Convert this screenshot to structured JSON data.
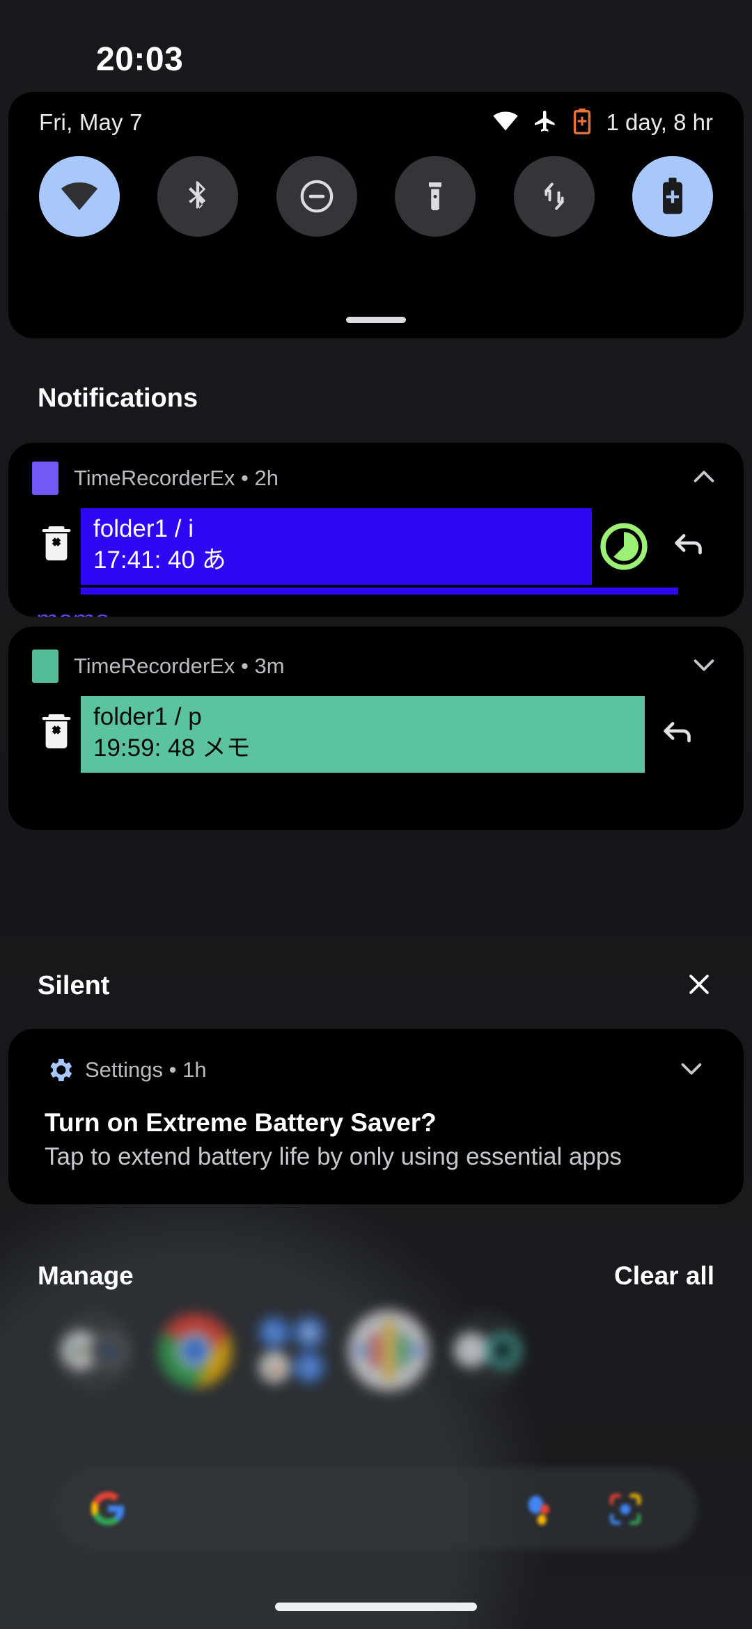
{
  "status_bar": {
    "clock": "20:03"
  },
  "quick_settings": {
    "date": "Fri, May 7",
    "battery_estimate": "1 day, 8 hr",
    "status_icons": [
      {
        "name": "wifi-icon"
      },
      {
        "name": "airplane-mode-icon"
      },
      {
        "name": "battery-saver-icon",
        "color": "#e8703a"
      }
    ],
    "tiles": [
      {
        "name": "wifi-tile",
        "icon": "wifi-icon",
        "active": true
      },
      {
        "name": "bluetooth-tile",
        "icon": "bluetooth-icon",
        "active": false
      },
      {
        "name": "dnd-tile",
        "icon": "do-not-disturb-icon",
        "active": false
      },
      {
        "name": "flashlight-tile",
        "icon": "flashlight-icon",
        "active": false
      },
      {
        "name": "auto-rotate-tile",
        "icon": "auto-rotate-icon",
        "active": false
      },
      {
        "name": "battery-saver-tile",
        "icon": "battery-plus-icon",
        "active": true
      }
    ],
    "active_tile_color": "#a8c7fa",
    "inactive_tile_color": "#333538"
  },
  "sections": {
    "notifications_label": "Notifications",
    "silent_label": "Silent",
    "silent_clear_icon": "close-icon"
  },
  "notifications": [
    {
      "app_name": "TimeRecorderEx",
      "time": "2h",
      "header": "TimeRecorderEx • 2h",
      "app_color": "#7259f5",
      "expand_icon": "chevron-up-icon",
      "delete_icon": "trash-x-icon",
      "line1": "folder1 / i",
      "line2": "17:41: 40 あ",
      "box_color": "#2f07f2",
      "text_color": "#ffffff",
      "timer_icon": "pie-timer-icon",
      "timer_color": "#9cf073",
      "reply_icon": "reply-icon",
      "action_label": "memo",
      "action_color": "#5b44e8",
      "has_progress": true
    },
    {
      "app_name": "TimeRecorderEx",
      "time": "3m",
      "header": "TimeRecorderEx • 3m",
      "app_color": "#53bc96",
      "expand_icon": "chevron-down-icon",
      "delete_icon": "trash-x-icon",
      "line1": "folder1 / p",
      "line2": "19:59: 48 メモ",
      "box_color": "#5bc3a0",
      "text_color": "#0a0a0a",
      "reply_icon": "reply-icon",
      "has_progress": false
    }
  ],
  "silent_notification": {
    "app_name": "Settings",
    "time": "1h",
    "header": "Settings • 1h",
    "app_icon": "gear-icon",
    "app_icon_color": "#a8c7fa",
    "expand_icon": "chevron-down-icon",
    "title": "Turn on Extreme Battery Saver?",
    "body": "Tap to extend battery life by only using essential apps"
  },
  "footer": {
    "manage_label": "Manage",
    "clear_all_label": "Clear all"
  },
  "home_screen": {
    "search_bar": {
      "google_icon": "google-g-icon",
      "mic_icon": "assistant-mic-icon",
      "lens_icon": "google-lens-icon"
    },
    "dock_icons": [
      "play-store-folder-icon",
      "chrome-icon",
      "google-apps-folder-icon",
      "google-podcasts-icon",
      "media-folder-icon"
    ]
  }
}
